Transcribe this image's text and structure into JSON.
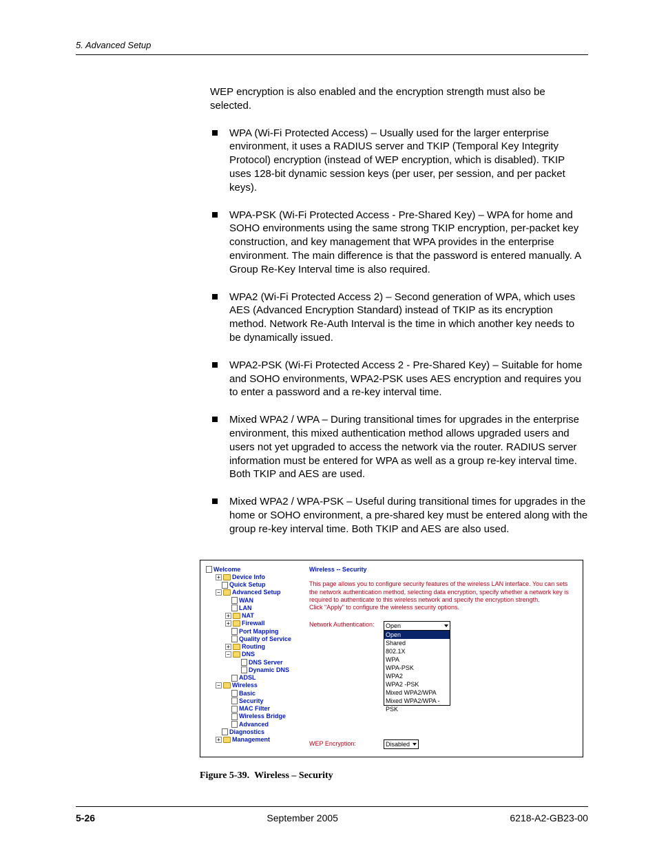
{
  "header": {
    "section": "5. Advanced Setup"
  },
  "intro": "WEP encryption is also enabled and the encryption strength must also be selected.",
  "bullets": [
    "WPA (Wi-Fi Protected Access) – Usually used for the larger enterprise environment, it uses a RADIUS server and TKIP (Temporal Key Integrity Protocol) encryption (instead of WEP encryption, which is disabled). TKIP uses 128-bit dynamic session keys (per user, per session, and per packet keys).",
    "WPA-PSK (Wi-Fi Protected Access - Pre-Shared Key) – WPA for home and SOHO environments using the same strong TKIP encryption, per-packet key construction, and key management that WPA provides in the enterprise environment. The main difference is that the password is entered manually. A Group Re-Key Interval time is also required.",
    "WPA2 (Wi-Fi Protected Access 2) – Second generation of WPA, which uses AES (Advanced Encryption Standard) instead of TKIP as its encryption method. Network Re-Auth Interval is the time in which another key needs to be dynamically issued.",
    "WPA2-PSK (Wi-Fi Protected Access 2 - Pre-Shared Key) – Suitable for home and SOHO environments, WPA2-PSK uses AES encryption and requires you to enter a password and a re-key interval time.",
    "Mixed WPA2 / WPA – During transitional times for upgrades in the enterprise environment, this mixed authentication method allows upgraded users and users not yet upgraded to access the network via the router. RADIUS server information must be entered for WPA as well as a group re-key interval time. Both TKIP and AES are used.",
    "Mixed WPA2 / WPA-PSK – Useful during transitional times for upgrades in the home or SOHO environment, a pre-shared key must be entered along with the group re-key interval time. Both TKIP and AES are also used."
  ],
  "figure": {
    "caption_label": "Figure 5-39.",
    "caption_title": "Wireless – Security",
    "tree": {
      "welcome": "Welcome",
      "device_info": "Device Info",
      "quick_setup": "Quick Setup",
      "advanced_setup": "Advanced Setup",
      "wan": "WAN",
      "lan": "LAN",
      "nat": "NAT",
      "firewall": "Firewall",
      "port_mapping": "Port Mapping",
      "qos": "Quality of Service",
      "routing": "Routing",
      "dns": "DNS",
      "dns_server": "DNS Server",
      "dyn_dns": "Dynamic DNS",
      "adsl": "ADSL",
      "wireless": "Wireless",
      "basic": "Basic",
      "security": "Security",
      "mac_filter": "MAC Filter",
      "wbridge": "Wireless Bridge",
      "advanced": "Advanced",
      "diagnostics": "Diagnostics",
      "management": "Management"
    },
    "panel": {
      "title": "Wireless -- Security",
      "desc1": "This page allows you to configure security features of the wireless LAN interface. You can sets the network authentication method, selecting data encryption, specify whether a network key is required to authenticate to this wireless network and specify the encryption strength.",
      "desc2": "Click \"Apply\" to configure the wireless security options.",
      "auth_label": "Network Authentication:",
      "auth_value": "Open",
      "auth_options": [
        "Open",
        "Shared",
        "802.1X",
        "WPA",
        "WPA-PSK",
        "WPA2",
        "WPA2 -PSK",
        "Mixed WPA2/WPA",
        "Mixed WPA2/WPA -PSK"
      ],
      "wep_label": "WEP Encryption:",
      "wep_value": "Disabled"
    }
  },
  "footer": {
    "page": "5-26",
    "date": "September 2005",
    "doc": "6218-A2-GB23-00"
  }
}
